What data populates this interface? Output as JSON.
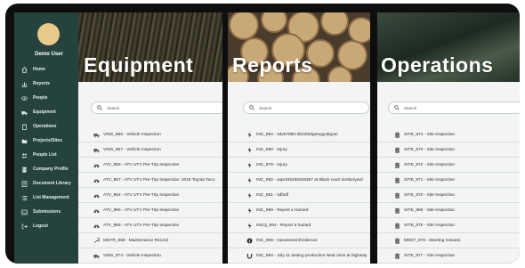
{
  "user": {
    "name": "Demo User"
  },
  "nav": [
    {
      "label": "Home",
      "icon": "home-icon"
    },
    {
      "label": "Reports",
      "icon": "chart-icon"
    },
    {
      "label": "People",
      "icon": "eye-icon"
    },
    {
      "label": "Equipment",
      "icon": "truck-icon"
    },
    {
      "label": "Operations",
      "icon": "clipboard-icon"
    },
    {
      "label": "Projects/Sites",
      "icon": "folder-icon"
    },
    {
      "label": "People List",
      "icon": "users-icon"
    },
    {
      "label": "Company Profile",
      "icon": "building-icon"
    },
    {
      "label": "Document Library",
      "icon": "book-icon"
    },
    {
      "label": "List Management",
      "icon": "list-icon"
    },
    {
      "label": "Submissions",
      "icon": "inbox-icon"
    },
    {
      "label": "Logout",
      "icon": "logout-icon"
    }
  ],
  "panels": [
    {
      "title": "Equipment",
      "search_placeholder": "Search",
      "rows": [
        {
          "icon": "truck-icon",
          "text": "VINS_869 - Vehicle Inspection"
        },
        {
          "icon": "truck-icon",
          "text": "VINS_967 - Vehicle Inspection"
        },
        {
          "icon": "atv-icon",
          "text": "ATV_956 - ATV UTV Pre-Trip Inspection"
        },
        {
          "icon": "atv-icon",
          "text": "ATV_957 - ATV UTV Pre-Trip Inspection: 2018 Toyota Taco"
        },
        {
          "icon": "atv-icon",
          "text": "ATV_964 - ATV UTV Pre-Trip Inspection"
        },
        {
          "icon": "atv-icon",
          "text": "ATV_965 - ATV UTV Pre-Trip Inspection"
        },
        {
          "icon": "atv-icon",
          "text": "ATV_966 - ATV UTV Pre-Trip Inspection"
        },
        {
          "icon": "wrench-icon",
          "text": "MNTR_968 - Maintenance Record"
        },
        {
          "icon": "truck-icon",
          "text": "VINS_974 - Vehicle Inspection"
        }
      ]
    },
    {
      "title": "Reports",
      "search_placeholder": "Search",
      "rows": [
        {
          "icon": "bolt-icon",
          "text": "INC_864 - sdv67890-35235tdgetugyukguei"
        },
        {
          "icon": "bolt-icon",
          "text": "INC_880 - Injury"
        },
        {
          "icon": "bolt-icon",
          "text": "INC_879 - Injury"
        },
        {
          "icon": "bolt-icon",
          "text": "INC_862 - wqe345436346367 at Black court lumberyard"
        },
        {
          "icon": "bolt-icon",
          "text": "INC_861 - sdfsdf"
        },
        {
          "icon": "bolt-icon",
          "text": "INC_869 - Report a Hazard"
        },
        {
          "icon": "bolt-icon",
          "text": "INCQ_864 - Report a hazard"
        },
        {
          "icon": "info-icon",
          "text": "INC_908 - Harassment/Violence"
        },
        {
          "icon": "magnet-icon",
          "text": "INC_883 - July 11 testing production Near miss at highway"
        }
      ]
    },
    {
      "title": "Operations",
      "search_placeholder": "Search",
      "rows": [
        {
          "icon": "clipboard-icon",
          "text": "SITE_874 - Site Inspection"
        },
        {
          "icon": "clipboard-icon",
          "text": "SITE_873 - Site Inspection"
        },
        {
          "icon": "clipboard-icon",
          "text": "SITE_872 - Site Inspection"
        },
        {
          "icon": "clipboard-icon",
          "text": "SITE_871 - Site Inspection"
        },
        {
          "icon": "clipboard-icon",
          "text": "SITE_870 - Site Inspection"
        },
        {
          "icon": "clipboard-icon",
          "text": "SITE_868 - Site Inspection"
        },
        {
          "icon": "clipboard-icon",
          "text": "SITE_875 - Site Inspection"
        },
        {
          "icon": "clipboard-icon",
          "text": "MEET_876 - Meeting minutes"
        },
        {
          "icon": "clipboard-icon",
          "text": "SITE_877 - Site Inspection"
        }
      ]
    }
  ],
  "colors": {
    "sidebar": "#25423c",
    "avatar": "#e8c98a",
    "frame": "#0e0e0e"
  }
}
